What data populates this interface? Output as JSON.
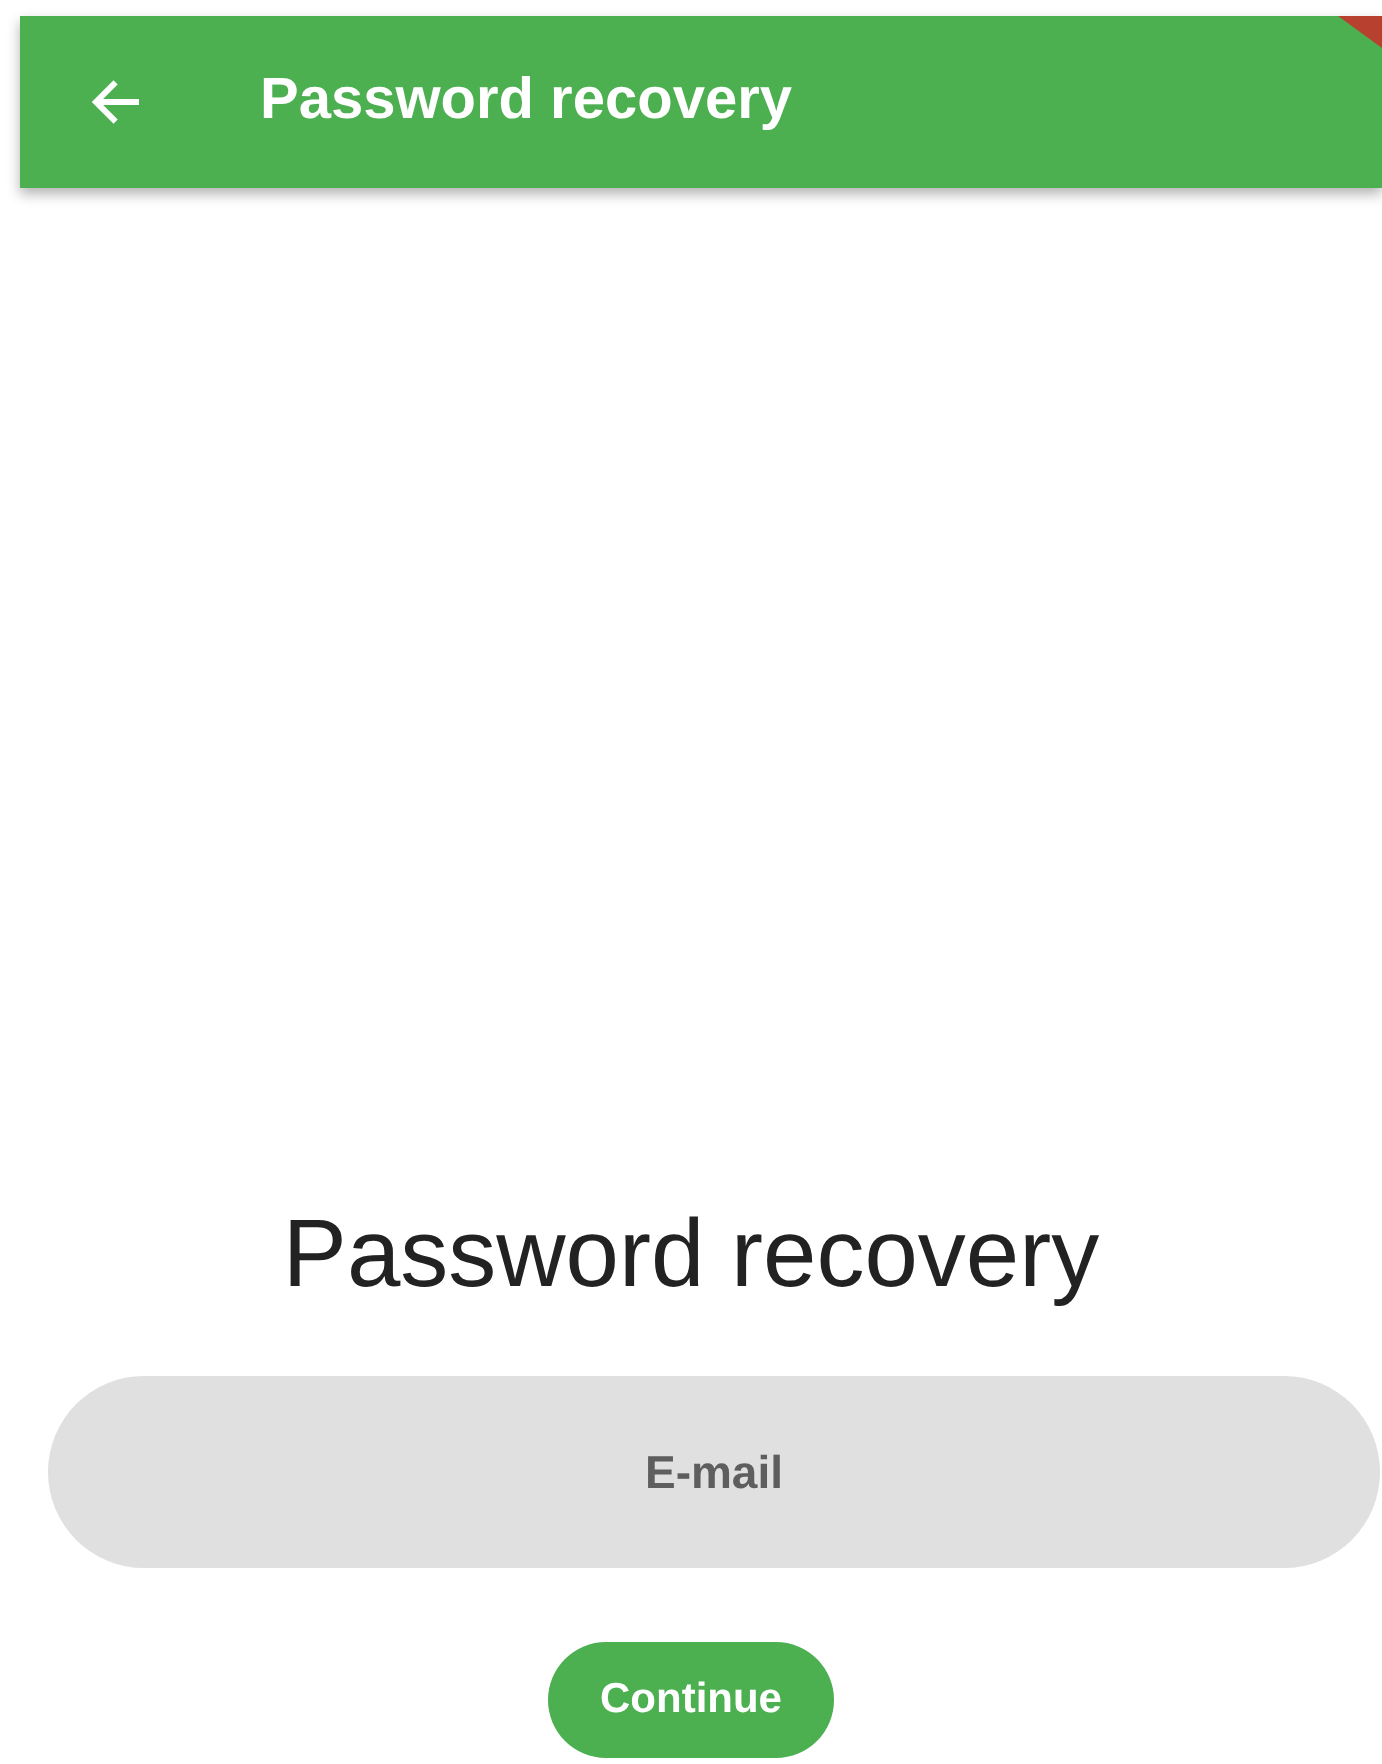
{
  "app_bar": {
    "title": "Password recovery"
  },
  "heading": "Password recovery",
  "email_field": {
    "placeholder": "E-mail"
  },
  "continue_button": {
    "label": "Continue"
  }
}
